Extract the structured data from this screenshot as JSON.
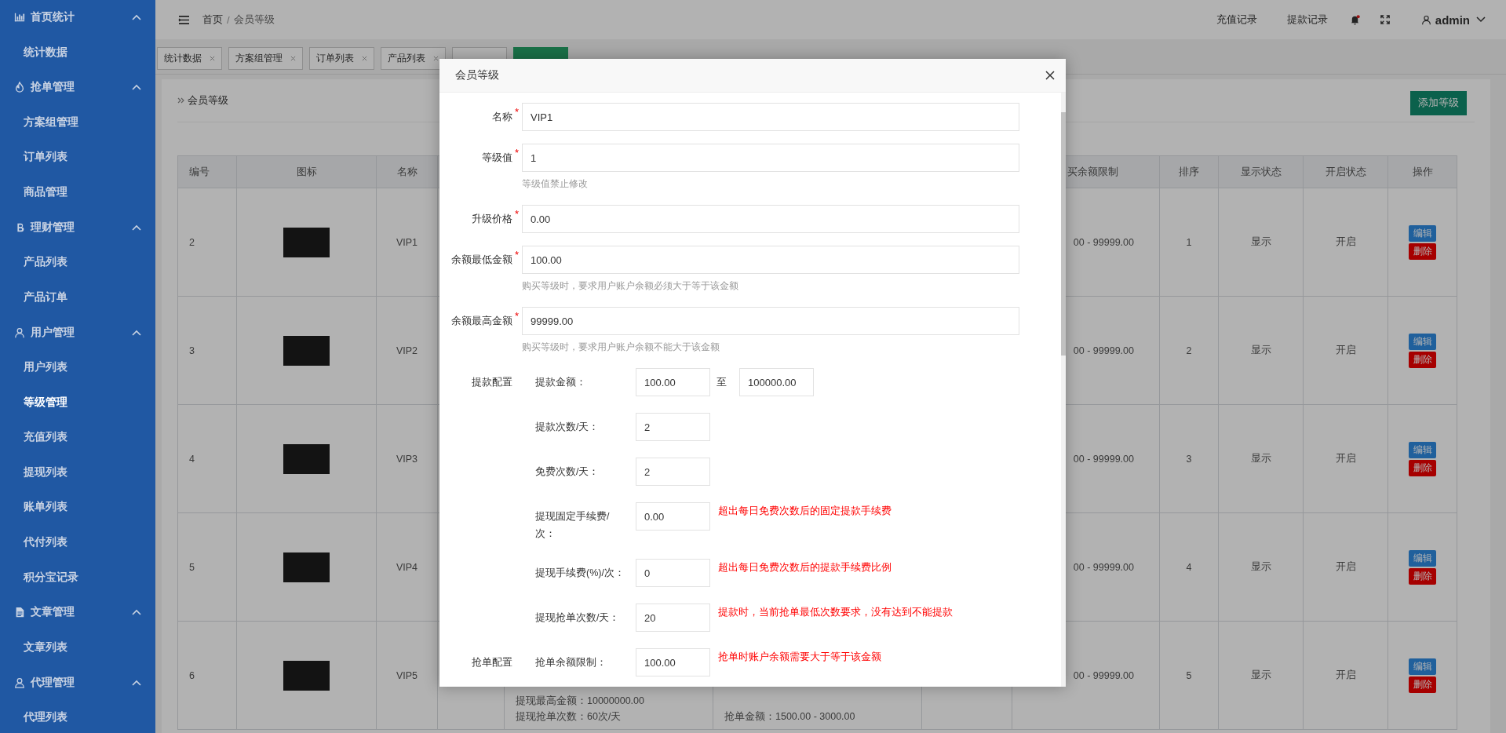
{
  "sidebar": {
    "groups": [
      {
        "label": "首页统计",
        "expanded": true,
        "items": [
          {
            "label": "统计数据",
            "selected": false
          }
        ]
      },
      {
        "label": "抢单管理",
        "expanded": true,
        "items": [
          {
            "label": "方案组管理",
            "selected": false
          },
          {
            "label": "订单列表",
            "selected": false
          },
          {
            "label": "商品管理",
            "selected": false
          }
        ]
      },
      {
        "label": "理财管理",
        "expanded": true,
        "items": [
          {
            "label": "产品列表",
            "selected": false
          },
          {
            "label": "产品订单",
            "selected": false
          }
        ]
      },
      {
        "label": "用户管理",
        "expanded": true,
        "items": [
          {
            "label": "用户列表",
            "selected": false
          },
          {
            "label": "等级管理",
            "selected": true
          },
          {
            "label": "充值列表",
            "selected": false
          },
          {
            "label": "提现列表",
            "selected": false
          },
          {
            "label": "账单列表",
            "selected": false
          },
          {
            "label": "代付列表",
            "selected": false
          },
          {
            "label": "积分宝记录",
            "selected": false
          }
        ]
      },
      {
        "label": "文章管理",
        "expanded": true,
        "items": [
          {
            "label": "文章列表",
            "selected": false
          }
        ]
      },
      {
        "label": "代理管理",
        "expanded": true,
        "items": [
          {
            "label": "代理列表",
            "selected": false
          }
        ]
      }
    ]
  },
  "topbar": {
    "breadcrumb": [
      "首页",
      "会员等级"
    ],
    "separator": "/",
    "links": [
      "充值记录",
      "提款记录"
    ],
    "user": "admin"
  },
  "tabs": [
    {
      "label": "统计数据",
      "selected": false
    },
    {
      "label": "方案组管理",
      "selected": false
    },
    {
      "label": "订单列表",
      "selected": false
    },
    {
      "label": "产品列表",
      "selected": false
    },
    {
      "selected": false
    },
    {
      "selected": true
    }
  ],
  "page": {
    "title": "会员等级",
    "add_button": "添加等级"
  },
  "table": {
    "columns_left": [
      "编号",
      "图标",
      "名称"
    ],
    "columns_right": [
      "买余额限制",
      "排序",
      "显示状态",
      "开启状态",
      "操作"
    ],
    "rows": [
      {
        "id": "2",
        "name": "VIP1",
        "limit": "00 - 99999.00",
        "order": "1",
        "display": "显示",
        "status": "开启",
        "actions": [
          "编辑",
          "删除"
        ]
      },
      {
        "id": "3",
        "name": "VIP2",
        "limit": "00 - 99999.00",
        "order": "2",
        "display": "显示",
        "status": "开启",
        "actions": [
          "编辑",
          "删除"
        ]
      },
      {
        "id": "4",
        "name": "VIP3",
        "limit": "00 - 99999.00",
        "order": "3",
        "display": "显示",
        "status": "开启",
        "actions": [
          "编辑",
          "删除"
        ]
      },
      {
        "id": "5",
        "name": "VIP4",
        "limit": "00 - 99999.00",
        "order": "4",
        "display": "显示",
        "status": "开启",
        "actions": [
          "编辑",
          "删除"
        ]
      },
      {
        "id": "6",
        "name": "VIP5",
        "limit": "00 - 99999.00",
        "order": "5",
        "display": "显示",
        "status": "开启",
        "actions": [
          "编辑",
          "删除"
        ],
        "withdraw_lines": [
          "提现最高金额：10000000.00",
          "提现抢单次数：60次/天"
        ],
        "grab_lines": [
          "抢单金额：1500.00 - 3000.00"
        ]
      }
    ]
  },
  "modal": {
    "title": "会员等级",
    "required_mark": "*",
    "fields": [
      {
        "label": "名称",
        "required": true,
        "value": "VIP1"
      },
      {
        "label": "等级值",
        "required": true,
        "value": "1",
        "help": "等级值禁止修改"
      },
      {
        "label": "升级价格",
        "required": true,
        "value": "0.00"
      },
      {
        "label": "余额最低金额",
        "required": true,
        "value": "100.00",
        "help": "购买等级时，要求用户账户余额必须大于等于该金额"
      },
      {
        "label": "余额最高金额",
        "required": true,
        "value": "99999.00",
        "help": "购买等级时，要求用户账户余额不能大于该金额"
      }
    ],
    "sections": [
      {
        "label": "提款配置",
        "fields": [
          {
            "kind": "range",
            "label": "提款金额：",
            "value": "100.00",
            "joiner": "至",
            "value_to": "100000.00"
          },
          {
            "kind": "single",
            "label": "提款次数/天：",
            "value": "2"
          },
          {
            "kind": "single",
            "label": "免费次数/天：",
            "value": "2"
          },
          {
            "kind": "single",
            "label": "提现固定手续费/次：",
            "value": "0.00",
            "note": "超出每日免费次数后的固定提款手续费"
          },
          {
            "kind": "single",
            "label": "提现手续费(%)/次：",
            "value": "0",
            "note": "超出每日免费次数后的提款手续费比例"
          },
          {
            "kind": "single",
            "label": "提现抢单次数/天：",
            "value": "20",
            "note": "提款时，当前抢单最低次数要求，没有达到不能提款"
          }
        ]
      },
      {
        "label": "抢单配置",
        "fields": [
          {
            "kind": "single",
            "label": "抢单余额限制：",
            "value": "100.00",
            "note": "抢单时账户余额需要大于等于该金额"
          }
        ]
      }
    ]
  }
}
